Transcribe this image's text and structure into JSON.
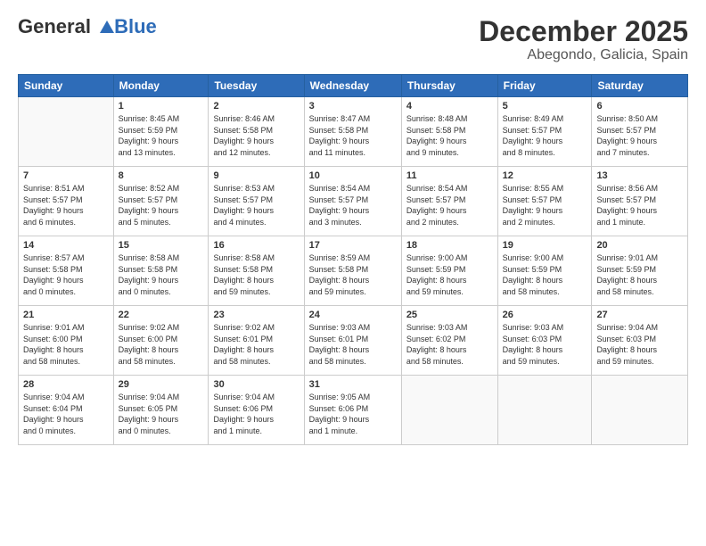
{
  "header": {
    "logo_line1": "General",
    "logo_line2": "Blue",
    "title": "December 2025",
    "subtitle": "Abegondo, Galicia, Spain"
  },
  "days_of_week": [
    "Sunday",
    "Monday",
    "Tuesday",
    "Wednesday",
    "Thursday",
    "Friday",
    "Saturday"
  ],
  "weeks": [
    [
      {
        "day": "",
        "info": ""
      },
      {
        "day": "1",
        "info": "Sunrise: 8:45 AM\nSunset: 5:59 PM\nDaylight: 9 hours\nand 13 minutes."
      },
      {
        "day": "2",
        "info": "Sunrise: 8:46 AM\nSunset: 5:58 PM\nDaylight: 9 hours\nand 12 minutes."
      },
      {
        "day": "3",
        "info": "Sunrise: 8:47 AM\nSunset: 5:58 PM\nDaylight: 9 hours\nand 11 minutes."
      },
      {
        "day": "4",
        "info": "Sunrise: 8:48 AM\nSunset: 5:58 PM\nDaylight: 9 hours\nand 9 minutes."
      },
      {
        "day": "5",
        "info": "Sunrise: 8:49 AM\nSunset: 5:57 PM\nDaylight: 9 hours\nand 8 minutes."
      },
      {
        "day": "6",
        "info": "Sunrise: 8:50 AM\nSunset: 5:57 PM\nDaylight: 9 hours\nand 7 minutes."
      }
    ],
    [
      {
        "day": "7",
        "info": "Sunrise: 8:51 AM\nSunset: 5:57 PM\nDaylight: 9 hours\nand 6 minutes."
      },
      {
        "day": "8",
        "info": "Sunrise: 8:52 AM\nSunset: 5:57 PM\nDaylight: 9 hours\nand 5 minutes."
      },
      {
        "day": "9",
        "info": "Sunrise: 8:53 AM\nSunset: 5:57 PM\nDaylight: 9 hours\nand 4 minutes."
      },
      {
        "day": "10",
        "info": "Sunrise: 8:54 AM\nSunset: 5:57 PM\nDaylight: 9 hours\nand 3 minutes."
      },
      {
        "day": "11",
        "info": "Sunrise: 8:54 AM\nSunset: 5:57 PM\nDaylight: 9 hours\nand 2 minutes."
      },
      {
        "day": "12",
        "info": "Sunrise: 8:55 AM\nSunset: 5:57 PM\nDaylight: 9 hours\nand 2 minutes."
      },
      {
        "day": "13",
        "info": "Sunrise: 8:56 AM\nSunset: 5:57 PM\nDaylight: 9 hours\nand 1 minute."
      }
    ],
    [
      {
        "day": "14",
        "info": "Sunrise: 8:57 AM\nSunset: 5:58 PM\nDaylight: 9 hours\nand 0 minutes."
      },
      {
        "day": "15",
        "info": "Sunrise: 8:58 AM\nSunset: 5:58 PM\nDaylight: 9 hours\nand 0 minutes."
      },
      {
        "day": "16",
        "info": "Sunrise: 8:58 AM\nSunset: 5:58 PM\nDaylight: 8 hours\nand 59 minutes."
      },
      {
        "day": "17",
        "info": "Sunrise: 8:59 AM\nSunset: 5:58 PM\nDaylight: 8 hours\nand 59 minutes."
      },
      {
        "day": "18",
        "info": "Sunrise: 9:00 AM\nSunset: 5:59 PM\nDaylight: 8 hours\nand 59 minutes."
      },
      {
        "day": "19",
        "info": "Sunrise: 9:00 AM\nSunset: 5:59 PM\nDaylight: 8 hours\nand 58 minutes."
      },
      {
        "day": "20",
        "info": "Sunrise: 9:01 AM\nSunset: 5:59 PM\nDaylight: 8 hours\nand 58 minutes."
      }
    ],
    [
      {
        "day": "21",
        "info": "Sunrise: 9:01 AM\nSunset: 6:00 PM\nDaylight: 8 hours\nand 58 minutes."
      },
      {
        "day": "22",
        "info": "Sunrise: 9:02 AM\nSunset: 6:00 PM\nDaylight: 8 hours\nand 58 minutes."
      },
      {
        "day": "23",
        "info": "Sunrise: 9:02 AM\nSunset: 6:01 PM\nDaylight: 8 hours\nand 58 minutes."
      },
      {
        "day": "24",
        "info": "Sunrise: 9:03 AM\nSunset: 6:01 PM\nDaylight: 8 hours\nand 58 minutes."
      },
      {
        "day": "25",
        "info": "Sunrise: 9:03 AM\nSunset: 6:02 PM\nDaylight: 8 hours\nand 58 minutes."
      },
      {
        "day": "26",
        "info": "Sunrise: 9:03 AM\nSunset: 6:03 PM\nDaylight: 8 hours\nand 59 minutes."
      },
      {
        "day": "27",
        "info": "Sunrise: 9:04 AM\nSunset: 6:03 PM\nDaylight: 8 hours\nand 59 minutes."
      }
    ],
    [
      {
        "day": "28",
        "info": "Sunrise: 9:04 AM\nSunset: 6:04 PM\nDaylight: 9 hours\nand 0 minutes."
      },
      {
        "day": "29",
        "info": "Sunrise: 9:04 AM\nSunset: 6:05 PM\nDaylight: 9 hours\nand 0 minutes."
      },
      {
        "day": "30",
        "info": "Sunrise: 9:04 AM\nSunset: 6:06 PM\nDaylight: 9 hours\nand 1 minute."
      },
      {
        "day": "31",
        "info": "Sunrise: 9:05 AM\nSunset: 6:06 PM\nDaylight: 9 hours\nand 1 minute."
      },
      {
        "day": "",
        "info": ""
      },
      {
        "day": "",
        "info": ""
      },
      {
        "day": "",
        "info": ""
      }
    ]
  ]
}
